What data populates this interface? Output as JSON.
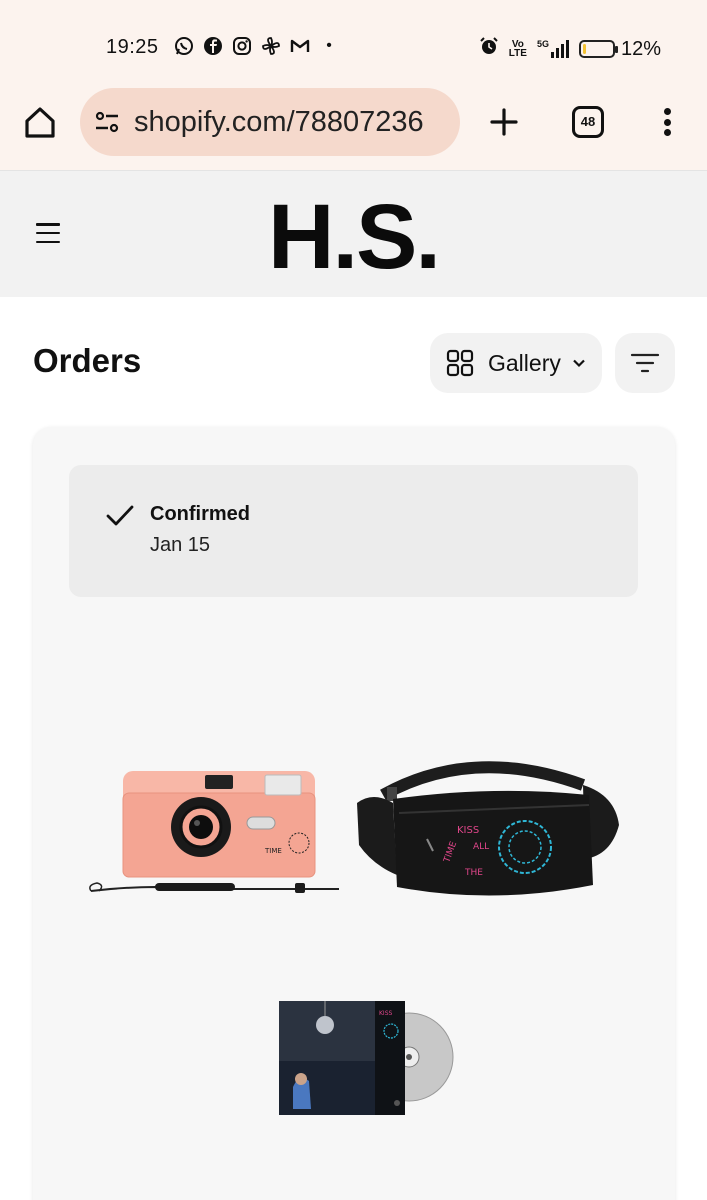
{
  "status_bar": {
    "time": "19:25",
    "app_icons": [
      "whatsapp-icon",
      "facebook-icon",
      "instagram-icon",
      "pinwheel-icon",
      "gmail-icon"
    ],
    "more_dot": "•",
    "network_top": "Vo",
    "network_bottom": "LTE",
    "network_5g": "5G",
    "battery": "12%",
    "battery_level": 0.12
  },
  "browser": {
    "url": "shopify.com/78807236",
    "tab_count": "48"
  },
  "store": {
    "logo": "H.S."
  },
  "orders": {
    "title": "Orders",
    "view_label": "Gallery"
  },
  "order": {
    "status": "Confirmed",
    "date": "Jan 15",
    "products": [
      {
        "name": "camera-product-image",
        "icon": "pink film camera with wrist strap"
      },
      {
        "name": "bag-product-image",
        "icon": "black waist bag with neon print"
      },
      {
        "name": "album-product-image",
        "icon": "CD album with cover art"
      }
    ]
  },
  "colors": {
    "chrome_bg": "#fcf3ee",
    "url_bg": "#f5d9cc",
    "header_bg": "#f2f2f2",
    "card_bg": "#f7f7f7",
    "camera_pink": "#f4a593",
    "neon_pink": "#e0468a",
    "neon_cyan": "#2fb7d6"
  }
}
